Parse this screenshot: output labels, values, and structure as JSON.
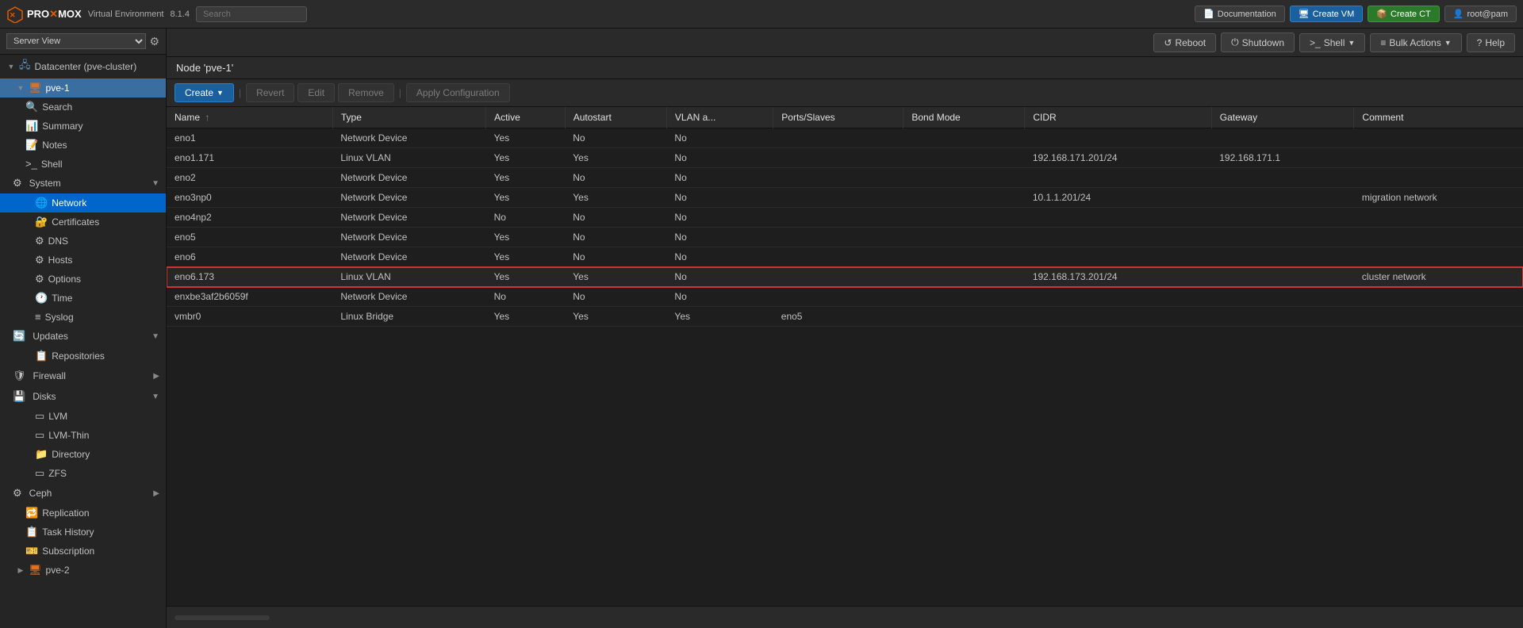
{
  "topbar": {
    "logo_text": "PROXMOX",
    "product_name": "Virtual Environment",
    "version": "8.1.4",
    "search_placeholder": "Search",
    "doc_btn": "Documentation",
    "create_vm_btn": "Create VM",
    "create_ct_btn": "Create CT",
    "user_btn": "root@pam",
    "reboot_btn": "Reboot",
    "shutdown_btn": "Shutdown",
    "shell_btn": "Shell",
    "bulk_actions_btn": "Bulk Actions",
    "help_btn": "Help"
  },
  "sidebar": {
    "view_label": "Server View",
    "datacenter_label": "Datacenter (pve-cluster)",
    "pve1_label": "pve-1",
    "pve2_label": "pve-2",
    "menu_items": [
      {
        "id": "search",
        "label": "Search",
        "indent": 1
      },
      {
        "id": "summary",
        "label": "Summary",
        "indent": 1
      },
      {
        "id": "notes",
        "label": "Notes",
        "indent": 1
      },
      {
        "id": "shell",
        "label": "Shell",
        "indent": 1
      },
      {
        "id": "system",
        "label": "System",
        "indent": 1,
        "expandable": true
      },
      {
        "id": "network",
        "label": "Network",
        "indent": 2,
        "active": true
      },
      {
        "id": "certificates",
        "label": "Certificates",
        "indent": 2
      },
      {
        "id": "dns",
        "label": "DNS",
        "indent": 2
      },
      {
        "id": "hosts",
        "label": "Hosts",
        "indent": 2
      },
      {
        "id": "options",
        "label": "Options",
        "indent": 2
      },
      {
        "id": "time",
        "label": "Time",
        "indent": 2
      },
      {
        "id": "syslog",
        "label": "Syslog",
        "indent": 2
      },
      {
        "id": "updates",
        "label": "Updates",
        "indent": 1,
        "expandable": true
      },
      {
        "id": "repositories",
        "label": "Repositories",
        "indent": 2
      },
      {
        "id": "firewall",
        "label": "Firewall",
        "indent": 1,
        "expandable": true
      },
      {
        "id": "disks",
        "label": "Disks",
        "indent": 1,
        "expandable": true
      },
      {
        "id": "lvm",
        "label": "LVM",
        "indent": 2
      },
      {
        "id": "lvm-thin",
        "label": "LVM-Thin",
        "indent": 2
      },
      {
        "id": "directory",
        "label": "Directory",
        "indent": 2
      },
      {
        "id": "zfs",
        "label": "ZFS",
        "indent": 2
      },
      {
        "id": "ceph",
        "label": "Ceph",
        "indent": 1,
        "expandable": true
      },
      {
        "id": "replication",
        "label": "Replication",
        "indent": 1
      },
      {
        "id": "task-history",
        "label": "Task History",
        "indent": 1
      },
      {
        "id": "subscription",
        "label": "Subscription",
        "indent": 1
      }
    ]
  },
  "node_header": {
    "title": "Node 'pve-1'"
  },
  "toolbar": {
    "create_btn": "Create",
    "revert_btn": "Revert",
    "edit_btn": "Edit",
    "remove_btn": "Remove",
    "apply_config_btn": "Apply Configuration"
  },
  "table": {
    "columns": [
      {
        "id": "name",
        "label": "Name",
        "sortable": true,
        "sort_dir": "asc"
      },
      {
        "id": "type",
        "label": "Type"
      },
      {
        "id": "active",
        "label": "Active"
      },
      {
        "id": "autostart",
        "label": "Autostart"
      },
      {
        "id": "vlan_aware",
        "label": "VLAN a..."
      },
      {
        "id": "ports_slaves",
        "label": "Ports/Slaves"
      },
      {
        "id": "bond_mode",
        "label": "Bond Mode"
      },
      {
        "id": "cidr",
        "label": "CIDR"
      },
      {
        "id": "gateway",
        "label": "Gateway"
      },
      {
        "id": "comment",
        "label": "Comment"
      }
    ],
    "rows": [
      {
        "name": "eno1",
        "type": "Network Device",
        "active": "Yes",
        "autostart": "No",
        "vlan_aware": "No",
        "ports_slaves": "",
        "bond_mode": "",
        "cidr": "",
        "gateway": "",
        "comment": "",
        "selected": false
      },
      {
        "name": "eno1.171",
        "type": "Linux VLAN",
        "active": "Yes",
        "autostart": "Yes",
        "vlan_aware": "No",
        "ports_slaves": "",
        "bond_mode": "",
        "cidr": "192.168.171.201/24",
        "gateway": "192.168.171.1",
        "comment": "",
        "selected": false
      },
      {
        "name": "eno2",
        "type": "Network Device",
        "active": "Yes",
        "autostart": "No",
        "vlan_aware": "No",
        "ports_slaves": "",
        "bond_mode": "",
        "cidr": "",
        "gateway": "",
        "comment": "",
        "selected": false
      },
      {
        "name": "eno3np0",
        "type": "Network Device",
        "active": "Yes",
        "autostart": "Yes",
        "vlan_aware": "No",
        "ports_slaves": "",
        "bond_mode": "",
        "cidr": "10.1.1.201/24",
        "gateway": "",
        "comment": "migration network",
        "selected": false
      },
      {
        "name": "eno4np2",
        "type": "Network Device",
        "active": "No",
        "autostart": "No",
        "vlan_aware": "No",
        "ports_slaves": "",
        "bond_mode": "",
        "cidr": "",
        "gateway": "",
        "comment": "",
        "selected": false
      },
      {
        "name": "eno5",
        "type": "Network Device",
        "active": "Yes",
        "autostart": "No",
        "vlan_aware": "No",
        "ports_slaves": "",
        "bond_mode": "",
        "cidr": "",
        "gateway": "",
        "comment": "",
        "selected": false
      },
      {
        "name": "eno6",
        "type": "Network Device",
        "active": "Yes",
        "autostart": "No",
        "vlan_aware": "No",
        "ports_slaves": "",
        "bond_mode": "",
        "cidr": "",
        "gateway": "",
        "comment": "",
        "selected": false
      },
      {
        "name": "eno6.173",
        "type": "Linux VLAN",
        "active": "Yes",
        "autostart": "Yes",
        "vlan_aware": "No",
        "ports_slaves": "",
        "bond_mode": "",
        "cidr": "192.168.173.201/24",
        "gateway": "",
        "comment": "cluster network",
        "selected": true
      },
      {
        "name": "enxbe3af2b6059f",
        "type": "Network Device",
        "active": "No",
        "autostart": "No",
        "vlan_aware": "No",
        "ports_slaves": "",
        "bond_mode": "",
        "cidr": "",
        "gateway": "",
        "comment": "",
        "selected": false
      },
      {
        "name": "vmbr0",
        "type": "Linux Bridge",
        "active": "Yes",
        "autostart": "Yes",
        "vlan_aware": "Yes",
        "ports_slaves": "eno5",
        "bond_mode": "",
        "cidr": "",
        "gateway": "",
        "comment": "",
        "selected": false
      }
    ]
  },
  "colors": {
    "selected_border": "#cc3333",
    "active_nav": "#0066cc",
    "primary_btn": "#1a5f9e"
  }
}
